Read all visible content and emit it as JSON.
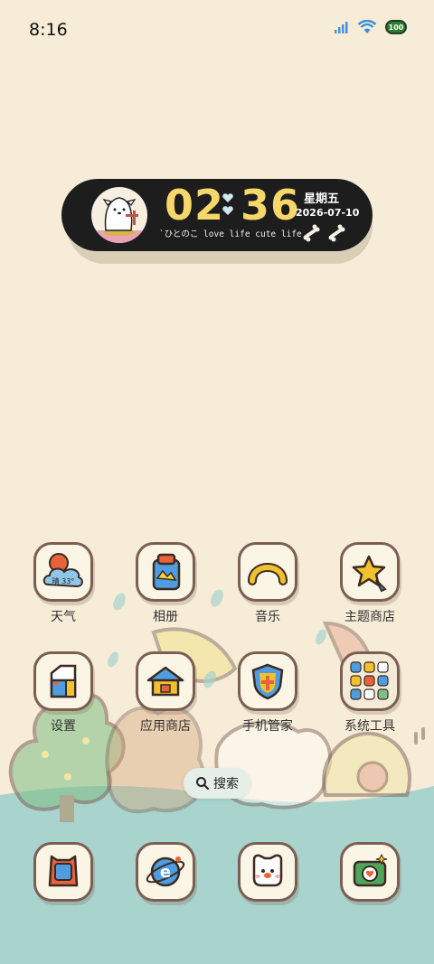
{
  "status_bar": {
    "time": "8:16",
    "battery": "100"
  },
  "clock_widget": {
    "hour": "02",
    "minute": "36",
    "tagline": "`ひとのこ love life cute life",
    "weekday": "星期五",
    "date": "2026-07-10"
  },
  "apps": {
    "row1": [
      "天气",
      "相册",
      "音乐",
      "主题商店"
    ],
    "row2": [
      "设置",
      "应用商店",
      "手机管家",
      "系统工具"
    ]
  },
  "weather_icon_text": "晴 33°",
  "search": {
    "label": "搜索"
  },
  "colors": {
    "background": "#f6ecd8",
    "clock_bg": "#1d1d1d",
    "clock_digits": "#f5d76a",
    "dock_teal": "#a9d3cd",
    "icon_border": "#7a5f52"
  },
  "dock": {
    "icons": [
      "phone-icon",
      "browser-icon",
      "messages-icon",
      "camera-icon"
    ]
  }
}
